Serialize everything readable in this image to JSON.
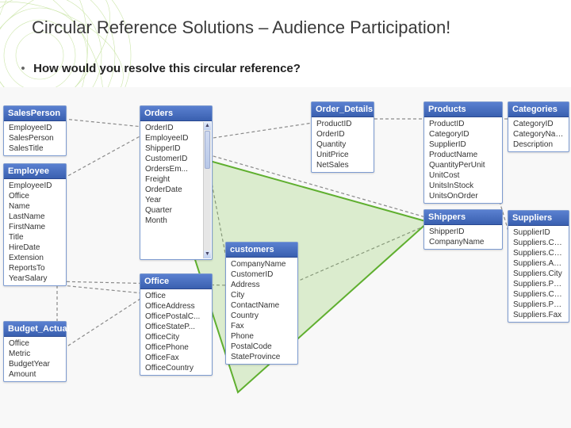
{
  "title": "Circular Reference Solutions – Audience Participation!",
  "bullet": "How would you resolve this circular reference?",
  "tables": {
    "salesperson": {
      "title": "SalesPerson",
      "fields": [
        "EmployeeID",
        "SalesPerson",
        "SalesTitle"
      ]
    },
    "employee": {
      "title": "Employee",
      "fields": [
        "EmployeeID",
        "Office",
        "Name",
        "LastName",
        "FirstName",
        "Title",
        "HireDate",
        "Extension",
        "ReportsTo",
        "YearSalary"
      ]
    },
    "budget": {
      "title": "Budget_Actual",
      "fields": [
        "Office",
        "Metric",
        "BudgetYear",
        "Amount"
      ]
    },
    "orders": {
      "title": "Orders",
      "fields": [
        "OrderID",
        "EmployeeID",
        "ShipperID",
        "CustomerID",
        "OrdersEm...",
        "Freight",
        "OrderDate",
        "Year",
        "Quarter",
        "Month"
      ],
      "scroll": true
    },
    "office": {
      "title": "Office",
      "fields": [
        "Office",
        "OfficeAddress",
        "OfficePostalC...",
        "OfficeStateP...",
        "OfficeCity",
        "OfficePhone",
        "OfficeFax",
        "OfficeCountry"
      ]
    },
    "customers": {
      "title": "customers",
      "fields": [
        "CompanyName",
        "CustomerID",
        "Address",
        "City",
        "ContactName",
        "Country",
        "Fax",
        "Phone",
        "PostalCode",
        "StateProvince"
      ]
    },
    "orderdetails": {
      "title": "Order_Details",
      "fields": [
        "ProductID",
        "OrderID",
        "Quantity",
        "UnitPrice",
        "NetSales"
      ]
    },
    "products": {
      "title": "Products",
      "fields": [
        "ProductID",
        "CategoryID",
        "SupplierID",
        "ProductName",
        "QuantityPerUnit",
        "UnitCost",
        "UnitsInStock",
        "UnitsOnOrder"
      ]
    },
    "shippers": {
      "title": "Shippers",
      "fields": [
        "ShipperID",
        "CompanyName"
      ]
    },
    "categories": {
      "title": "Categories",
      "fields": [
        "CategoryID",
        "CategoryName",
        "Description"
      ]
    },
    "suppliers": {
      "title": "Suppliers",
      "fields": [
        "SupplierID",
        "Suppliers.Co...",
        "Suppliers.Co...",
        "Suppliers.Ad...",
        "Suppliers.City",
        "Suppliers.Po...",
        "Suppliers.Co...",
        "Suppliers.Ph...",
        "Suppliers.Fax"
      ]
    }
  },
  "colors": {
    "triangle": "#6fbf3f",
    "line": "#888888"
  }
}
